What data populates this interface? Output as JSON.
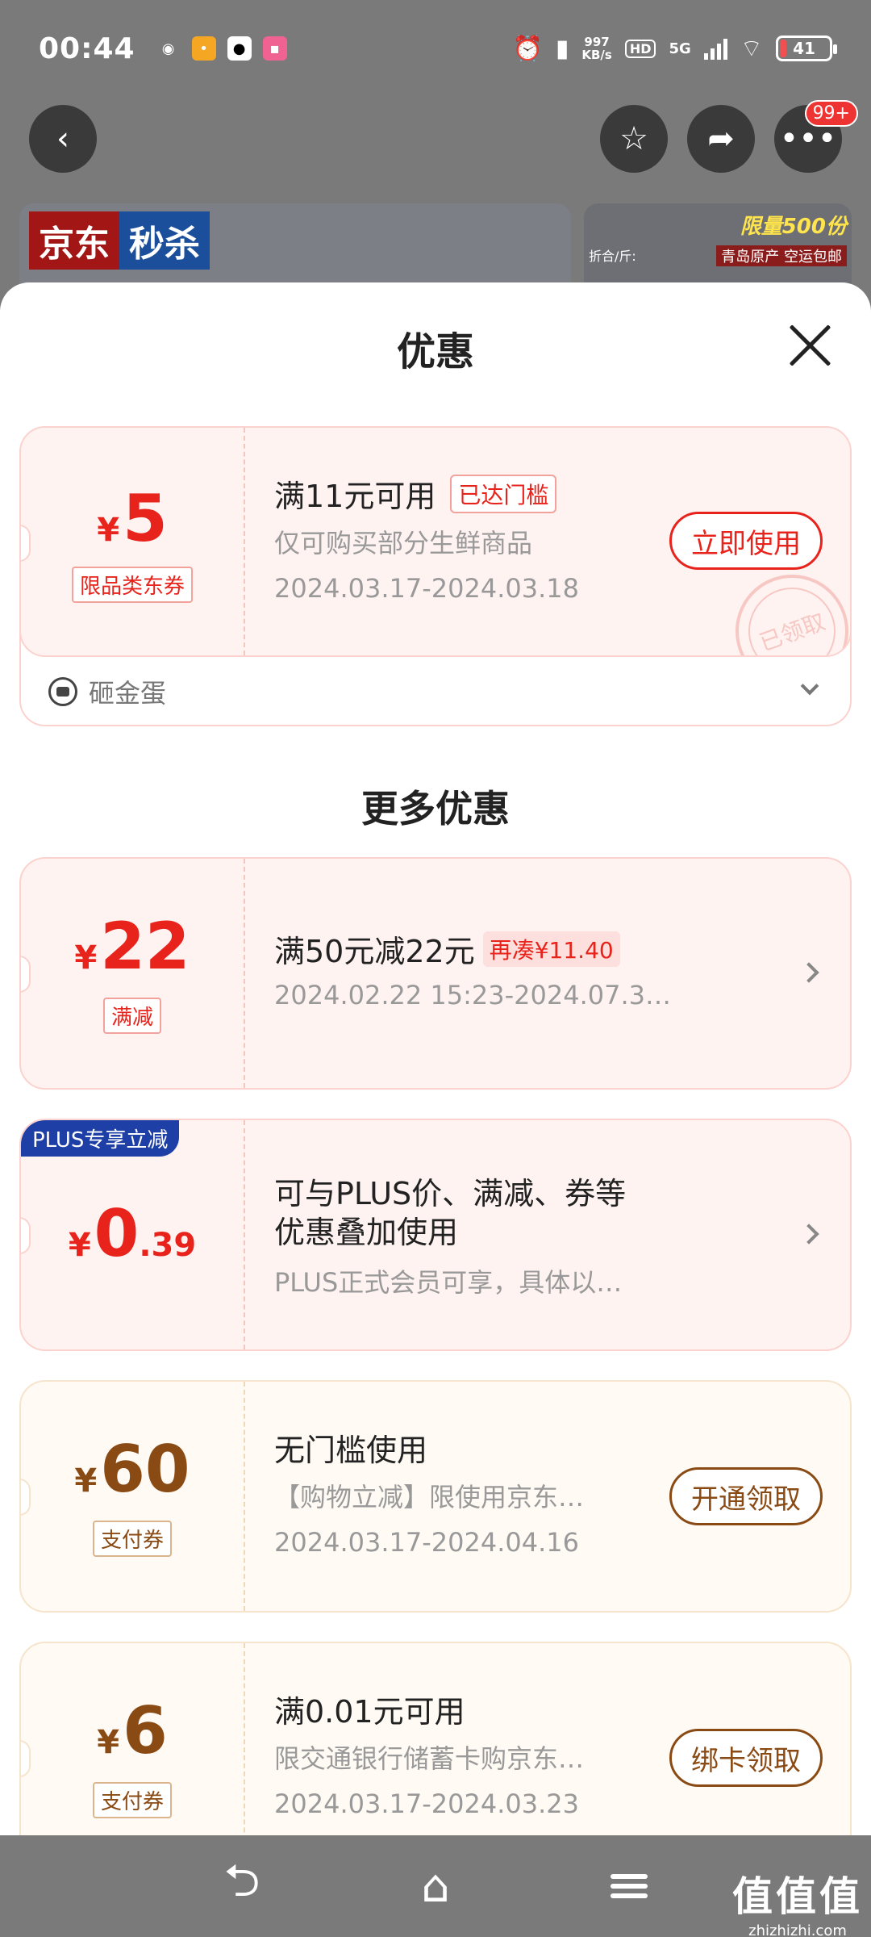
{
  "status_bar": {
    "time": "00:44",
    "net_speed_value": "997",
    "net_speed_unit": "KB/s",
    "hd": "HD",
    "network": "5G",
    "battery": "41"
  },
  "top_bar": {
    "notification_count": "99+"
  },
  "banners": {
    "left_tag_1": "京东",
    "left_tag_2": "秒杀",
    "right_limited": "限量500份",
    "right_origin": "青岛原产 空运包邮",
    "right_fold": "折合/斤:"
  },
  "sheet": {
    "title": "优惠"
  },
  "coupons": [
    {
      "yen": "¥",
      "amount": "5",
      "type": "限品类东券",
      "title": "满11元可用",
      "tag": "已达门槛",
      "desc": "仅可购买部分生鲜商品",
      "date": "2024.03.17-2024.03.18",
      "action": "立即使用",
      "stamp": "已领取",
      "source": "砸金蛋"
    }
  ],
  "more": {
    "title": "更多优惠"
  },
  "more_coupons": [
    {
      "yen": "¥",
      "amount": "22",
      "type": "满减",
      "title": "满50元减22元",
      "tag": "再凑¥11.40",
      "date": "2024.02.22 15:23-2024.07.3…"
    },
    {
      "badge": "PLUS专享立减",
      "yen": "¥",
      "amount": "0",
      "decimal": ".39",
      "title_line1": "可与PLUS价、满减、券等",
      "title_line2": "优惠叠加使用",
      "desc": "PLUS正式会员可享，具体以…"
    },
    {
      "yen": "¥",
      "amount": "60",
      "type": "支付券",
      "title": "无门槛使用",
      "desc": "【购物立减】限使用京东…",
      "date": "2024.03.17-2024.04.16",
      "action": "开通领取"
    },
    {
      "yen": "¥",
      "amount": "6",
      "type": "支付券",
      "title": "满0.01元可用",
      "desc": "限交通银行储蓄卡购京东…",
      "date": "2024.03.17-2024.03.23",
      "action": "绑卡领取"
    }
  ],
  "watermark": {
    "main": "值值值",
    "site": "zhizhizhi.com"
  }
}
